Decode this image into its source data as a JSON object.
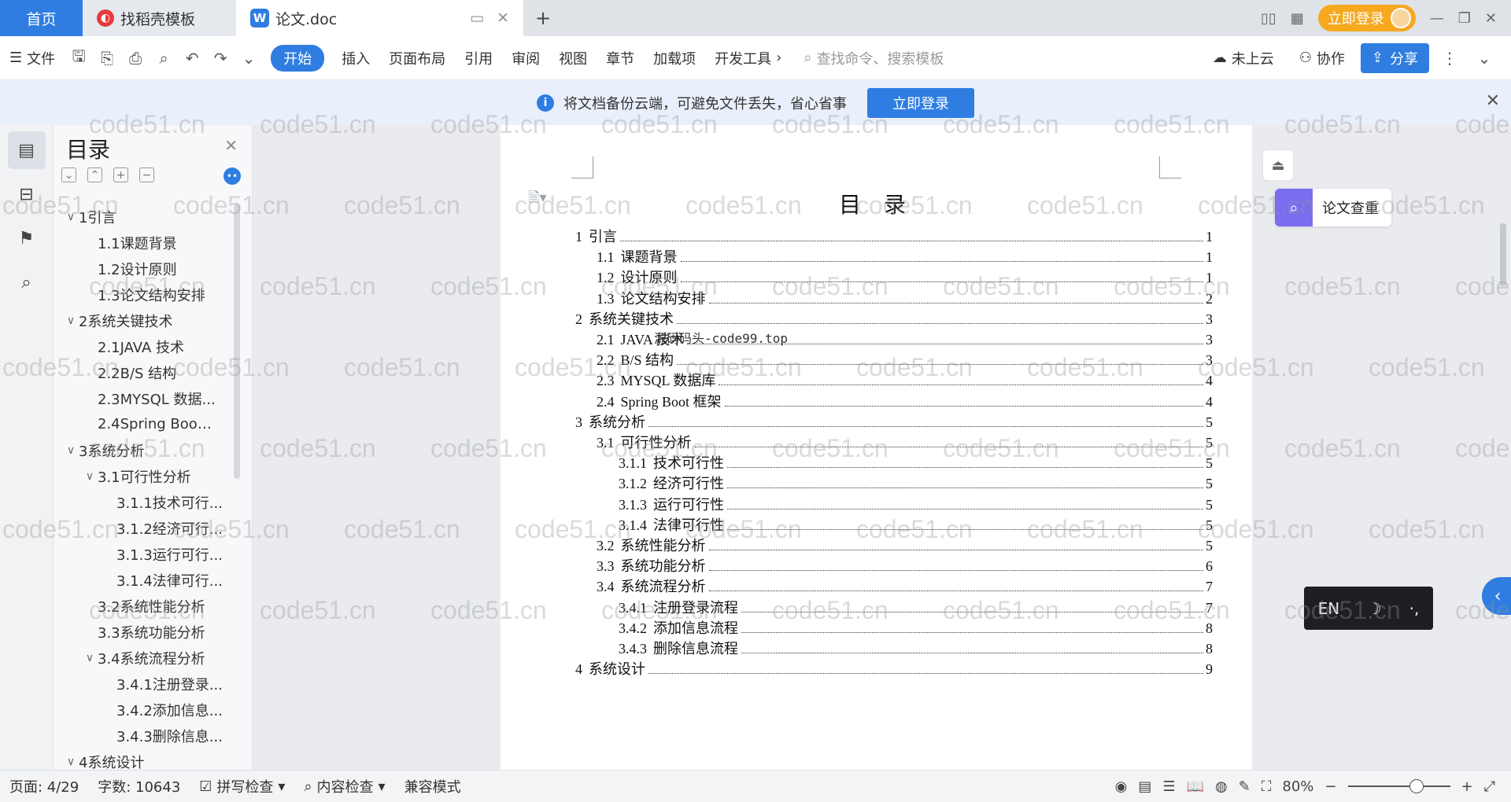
{
  "tabs": {
    "home": "首页",
    "template": "找稻壳模板",
    "doc": "论文.doc"
  },
  "titlebar": {
    "login": "立即登录"
  },
  "toolbar": {
    "file": "文件",
    "items": [
      "开始",
      "插入",
      "页面布局",
      "引用",
      "审阅",
      "视图",
      "章节",
      "加载项",
      "开发工具"
    ],
    "search_placeholder": "查找命令、搜索模板",
    "cloud": "未上云",
    "collab": "协作",
    "share": "分享"
  },
  "notice": {
    "text": "将文档备份云端，可避免文件丢失，省心省事",
    "button": "立即登录"
  },
  "navpane": {
    "title": "目录",
    "items": [
      {
        "text": "1引言",
        "level": 1,
        "chev": "∨"
      },
      {
        "text": "1.1课题背景",
        "level": 2
      },
      {
        "text": "1.2设计原则",
        "level": 2
      },
      {
        "text": "1.3论文结构安排",
        "level": 2
      },
      {
        "text": "2系统关键技术",
        "level": 1,
        "chev": "∨"
      },
      {
        "text": "2.1JAVA 技术",
        "level": 2
      },
      {
        "text": "2.2B/S 结构",
        "level": 2
      },
      {
        "text": "2.3MYSQL 数据...",
        "level": 2
      },
      {
        "text": "2.4Spring Boot ...",
        "level": 2
      },
      {
        "text": "3系统分析",
        "level": 1,
        "chev": "∨"
      },
      {
        "text": "3.1可行性分析",
        "level": 2,
        "chev": "∨"
      },
      {
        "text": "3.1.1技术可行...",
        "level": 3
      },
      {
        "text": "3.1.2经济可行...",
        "level": 3
      },
      {
        "text": "3.1.3运行可行...",
        "level": 3
      },
      {
        "text": "3.1.4法律可行...",
        "level": 3
      },
      {
        "text": "3.2系统性能分析",
        "level": 2
      },
      {
        "text": "3.3系统功能分析",
        "level": 2
      },
      {
        "text": "3.4系统流程分析",
        "level": 2,
        "chev": "∨"
      },
      {
        "text": "3.4.1注册登录...",
        "level": 3
      },
      {
        "text": "3.4.2添加信息...",
        "level": 3
      },
      {
        "text": "3.4.3删除信息...",
        "level": 3
      },
      {
        "text": "4系统设计",
        "level": 1,
        "chev": "∨"
      }
    ]
  },
  "document": {
    "title": "目 录",
    "overlay": "源码码头-code99.top",
    "toc": [
      {
        "num": "1",
        "label": "引言",
        "page": "1",
        "level": 1
      },
      {
        "num": "1.1",
        "label": "课题背景",
        "page": "1",
        "level": 2
      },
      {
        "num": "1.2",
        "label": "设计原则",
        "page": "1",
        "level": 2
      },
      {
        "num": "1.3",
        "label": "论文结构安排",
        "page": "2",
        "level": 2
      },
      {
        "num": "2",
        "label": "系统关键技术",
        "page": "3",
        "level": 1
      },
      {
        "num": "2.1",
        "label": "JAVA 技术",
        "page": "3",
        "level": 2
      },
      {
        "num": "2.2",
        "label": "B/S 结构",
        "page": "3",
        "level": 2
      },
      {
        "num": "2.3",
        "label": "MYSQL 数据库",
        "page": "4",
        "level": 2
      },
      {
        "num": "2.4",
        "label": "Spring Boot 框架",
        "page": "4",
        "level": 2
      },
      {
        "num": "3",
        "label": "系统分析",
        "page": "5",
        "level": 1
      },
      {
        "num": "3.1",
        "label": "可行性分析",
        "page": "5",
        "level": 2
      },
      {
        "num": "3.1.1",
        "label": "技术可行性",
        "page": "5",
        "level": 3
      },
      {
        "num": "3.1.2",
        "label": "经济可行性",
        "page": "5",
        "level": 3
      },
      {
        "num": "3.1.3",
        "label": "运行可行性",
        "page": "5",
        "level": 3
      },
      {
        "num": "3.1.4",
        "label": "法律可行性",
        "page": "5",
        "level": 3
      },
      {
        "num": "3.2",
        "label": "系统性能分析",
        "page": "5",
        "level": 2
      },
      {
        "num": "3.3",
        "label": "系统功能分析",
        "page": "6",
        "level": 2
      },
      {
        "num": "3.4",
        "label": "系统流程分析",
        "page": "7",
        "level": 2
      },
      {
        "num": "3.4.1",
        "label": "注册登录流程",
        "page": "7",
        "level": 3
      },
      {
        "num": "3.4.2",
        "label": "添加信息流程",
        "page": "8",
        "level": 3
      },
      {
        "num": "3.4.3",
        "label": "删除信息流程",
        "page": "8",
        "level": 3
      },
      {
        "num": "4",
        "label": "系统设计",
        "page": "9",
        "level": 1
      }
    ]
  },
  "side": {
    "check": "论文查重",
    "ime": [
      "EN",
      "☽",
      "·,"
    ]
  },
  "statusbar": {
    "page": "页面: 4/29",
    "words": "字数: 10643",
    "spell": "拼写检查",
    "content": "内容检查",
    "mode": "兼容模式",
    "zoom": "80%"
  },
  "watermark": "code51.cn",
  "colors": {
    "accent": "#2f7de1",
    "login": "#f6a81f"
  }
}
